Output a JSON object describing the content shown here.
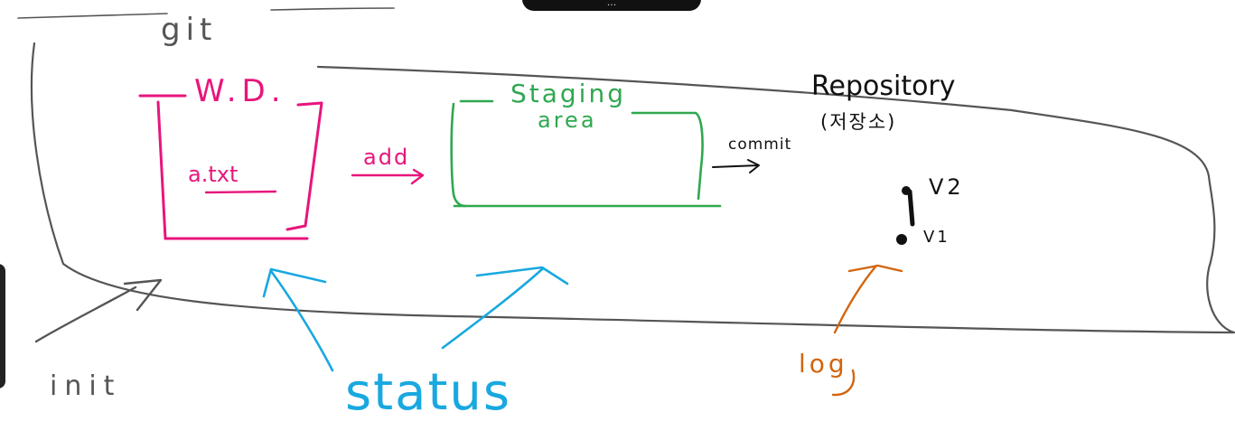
{
  "banner": {
    "text": "..."
  },
  "labels": {
    "git": "git",
    "working_dir": "W.D.",
    "file": "a.txt",
    "add": "add",
    "staging_area": "Staging\narea",
    "commit": "commit",
    "repository": "Repository",
    "repository_sub": "(저장소)",
    "v2": "V2",
    "v1": "V1",
    "init": "init",
    "status": "status",
    "log": "log"
  },
  "colors": {
    "outline": "#555555",
    "working_dir": "#e8157c",
    "staging": "#2fa84f",
    "repository": "#111111",
    "status": "#19a8e0",
    "log": "#d2650f"
  }
}
